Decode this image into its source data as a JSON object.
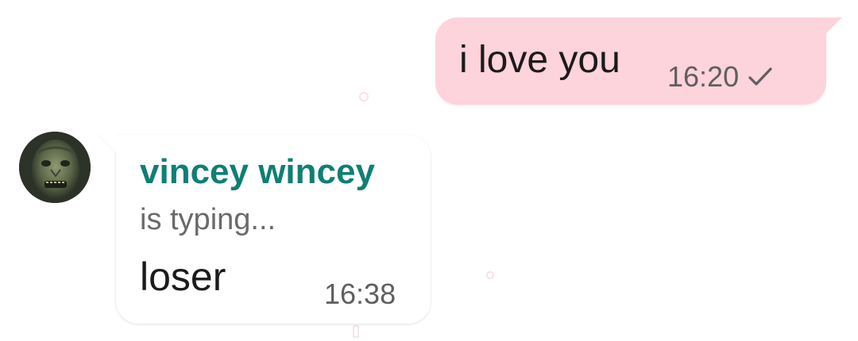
{
  "messages": {
    "outgoing": {
      "text": "i love you",
      "time": "16:20",
      "status_icon": "single-check-icon"
    },
    "incoming": {
      "sender": "vincey wincey",
      "status": "is typing...",
      "text": "loser",
      "time": "16:38",
      "avatar_icon": "avatar-photo-icon"
    }
  },
  "colors": {
    "outgoing_bubble": "#fdd3dc",
    "incoming_bubble": "#ffffff",
    "sender_name": "#0f7f74",
    "meta_text": "#5f5f5f"
  }
}
